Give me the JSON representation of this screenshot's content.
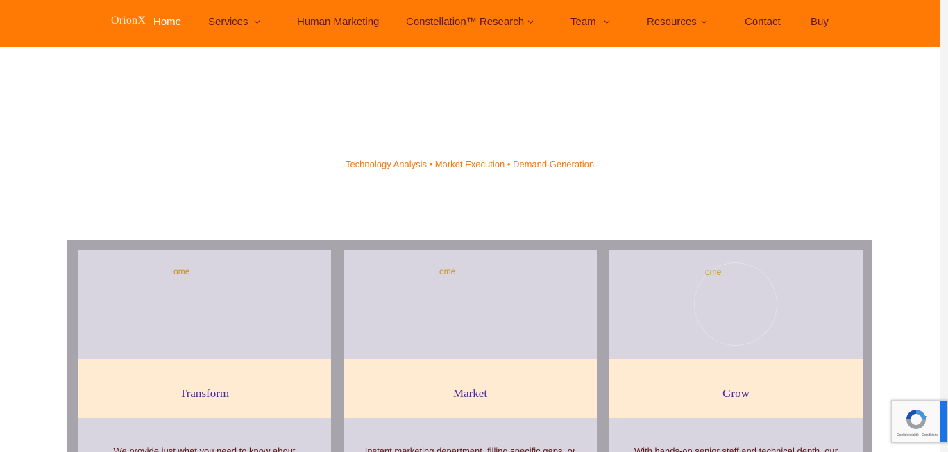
{
  "nav": {
    "logo": "OrionX",
    "items": [
      {
        "label": "Home"
      },
      {
        "label": "Services"
      },
      {
        "label": "Human Marketing"
      },
      {
        "label": "Constellation™ Research"
      },
      {
        "label": "Team"
      },
      {
        "label": "Resources"
      },
      {
        "label": "Contact"
      },
      {
        "label": "Buy"
      }
    ],
    "dropdown_icon": "chevron-down-icon"
  },
  "hero": {
    "tagline": "Technology Analysis • Market Execution • Demand Generation"
  },
  "cards": [
    {
      "image_alt": "ome",
      "title": "Transform",
      "description": "We provide just what you need to know about"
    },
    {
      "image_alt": "ome",
      "title": "Market",
      "description": "Instant marketing department, filling specific gaps, or"
    },
    {
      "image_alt": "ome",
      "title": "Grow",
      "description": "With hands-on senior staff and technical depth, our"
    }
  ],
  "recaptcha": {
    "links": "Confidentialité - Conditions"
  },
  "colors": {
    "nav_bg": "#ff7a05",
    "accent_text": "#ee7a1a",
    "card_title": "#4a2a9a",
    "card_panel": "#d8d4e0",
    "card_title_band": "#feebd2",
    "frame": "#a7a4ab"
  }
}
